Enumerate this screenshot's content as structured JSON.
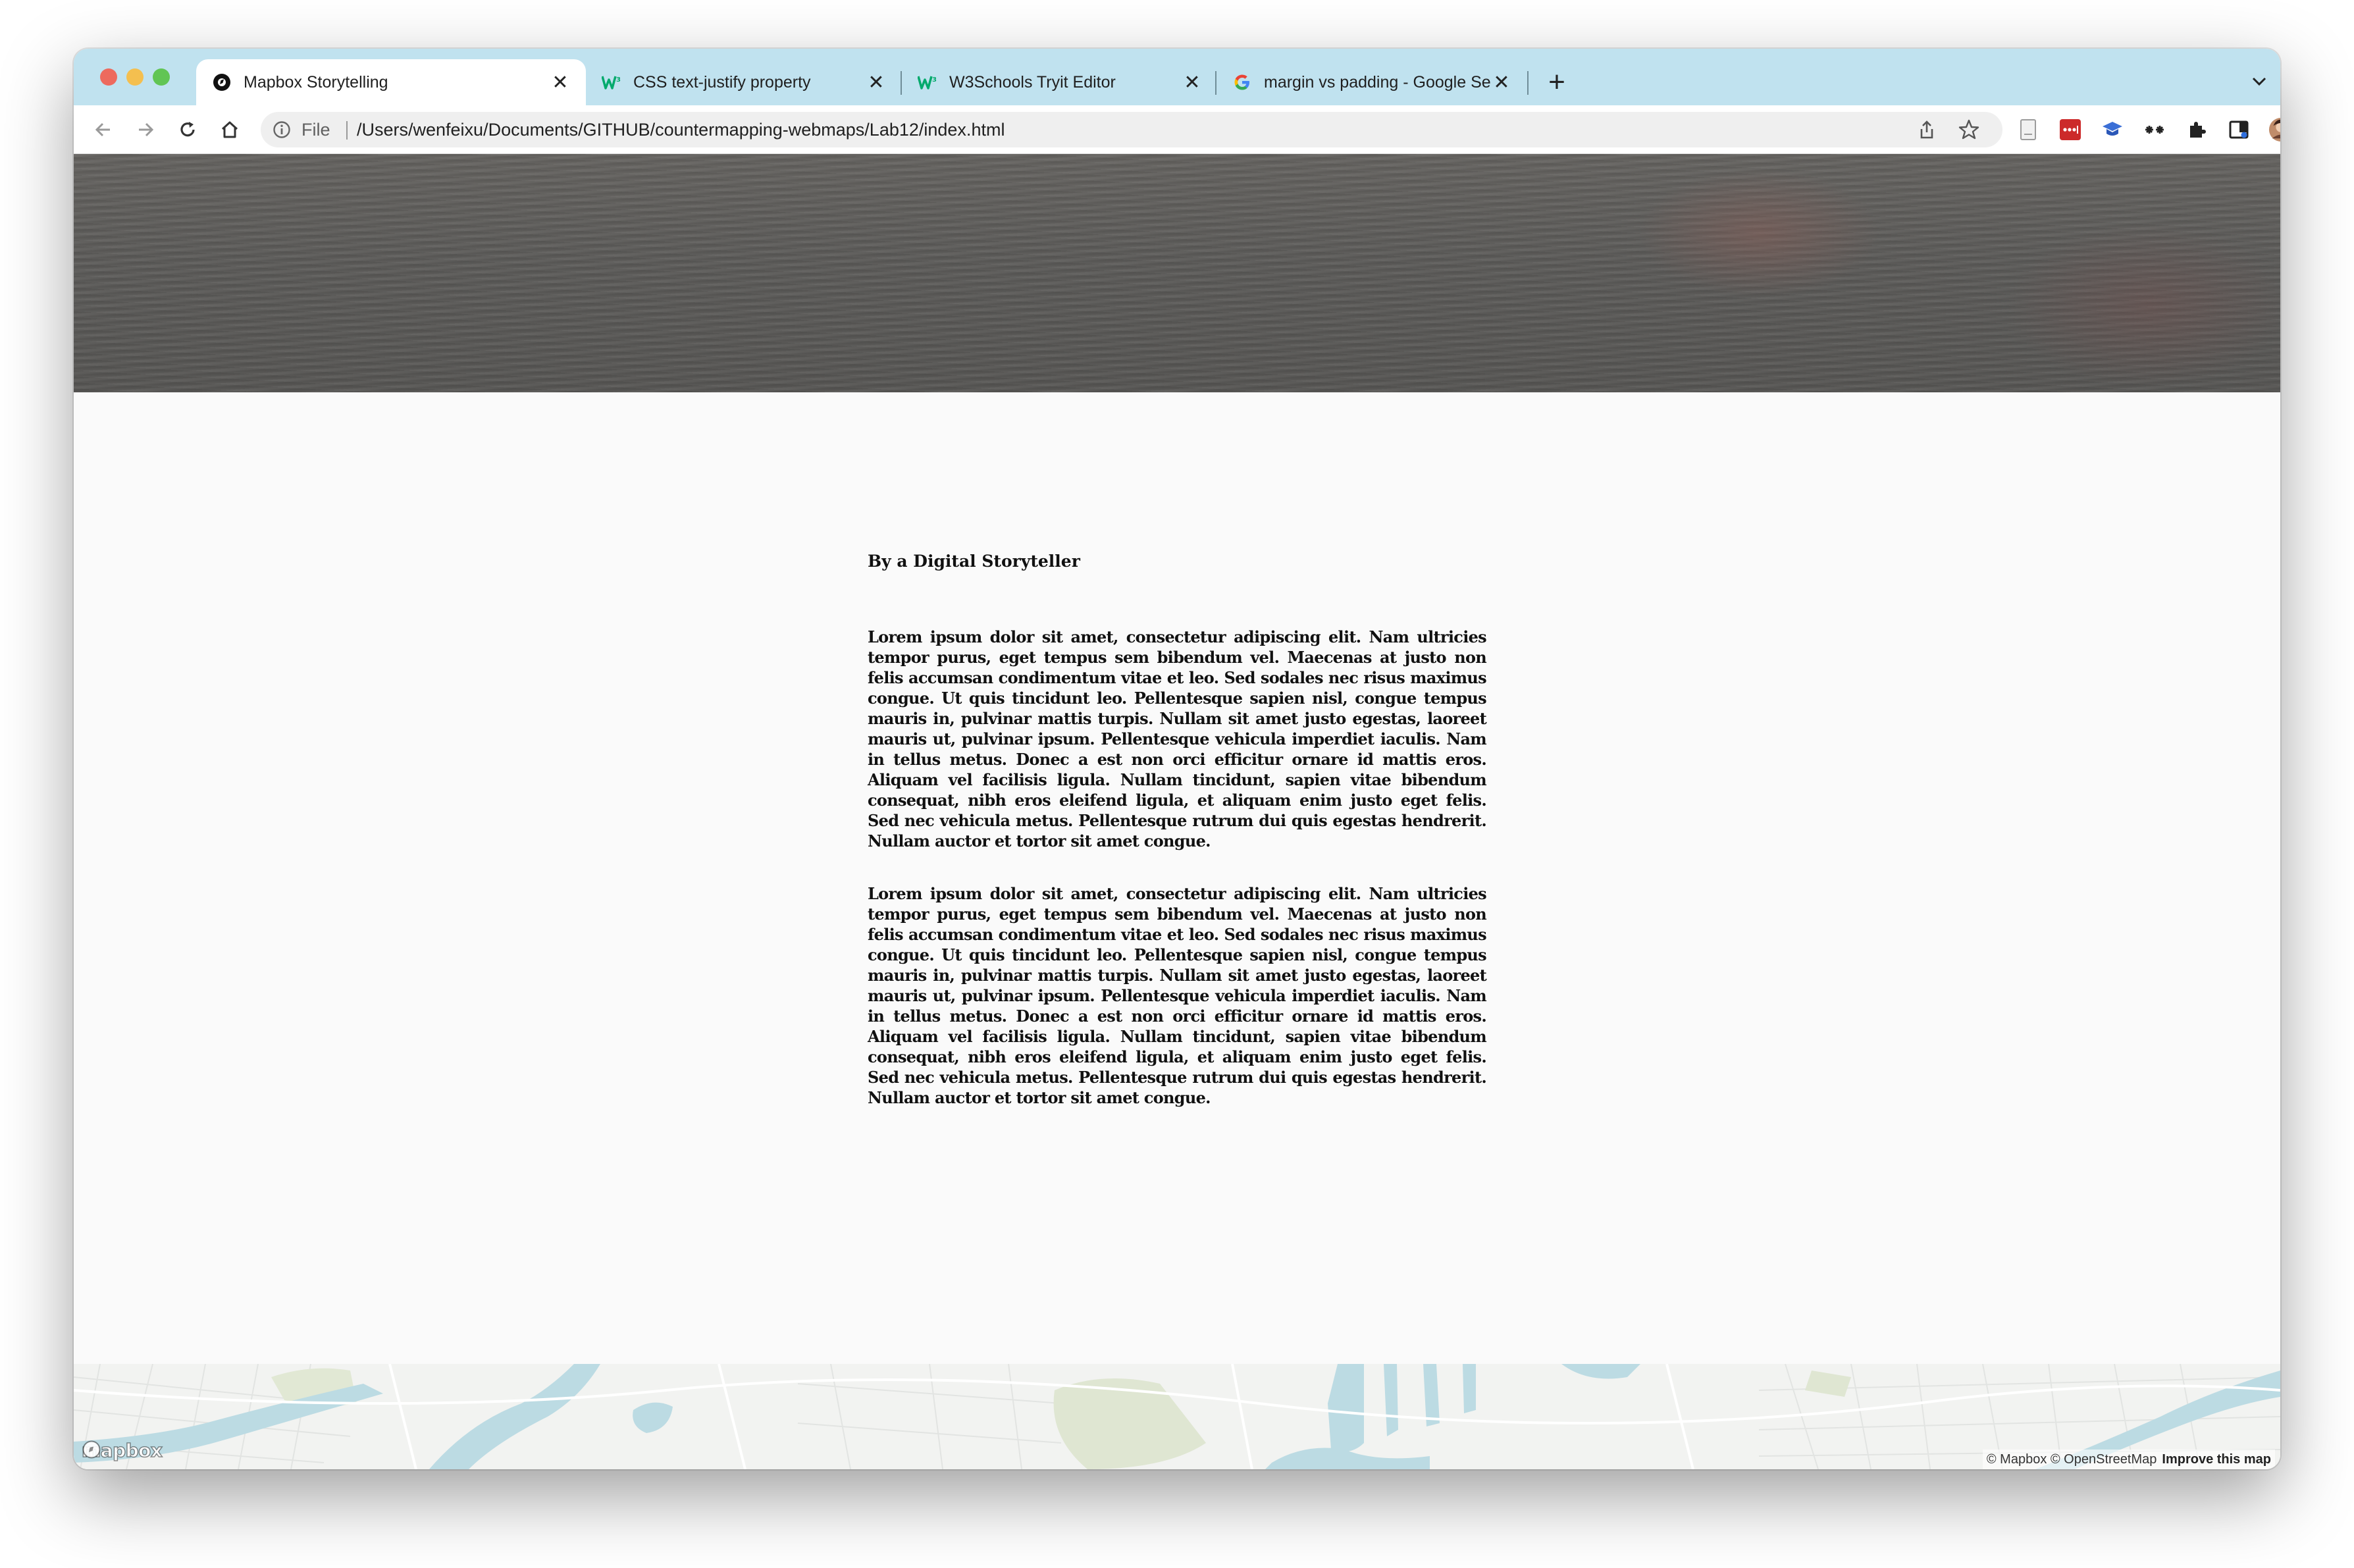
{
  "browser": {
    "tabs": [
      {
        "title": "Mapbox Storytelling",
        "favicon": "mapbox-icon",
        "active": true
      },
      {
        "title": "CSS text-justify property",
        "favicon": "w3schools-icon",
        "active": false
      },
      {
        "title": "W3Schools Tryit Editor",
        "favicon": "w3schools-icon",
        "active": false
      },
      {
        "title": "margin vs padding - Google Se",
        "favicon": "google-icon",
        "active": false
      }
    ],
    "new_tab": "+",
    "address": {
      "scheme_label": "File",
      "url": "/Users/wenfeixu/Documents/GITHUB/countermapping-webmaps/Lab12/index.html"
    },
    "close_glyph": "✕"
  },
  "page": {
    "byline": "By a Digital Storyteller",
    "paragraphs": [
      "Lorem ipsum dolor sit amet, consectetur adipiscing elit. Nam ultricies tempor purus, eget tempus sem bibendum vel. Maecenas at justo non felis accumsan condimentum vitae et leo. Sed sodales nec risus maximus congue. Ut quis tincidunt leo. Pellentesque sapien nisl, congue tempus mauris in, pulvinar mattis turpis. Nullam sit amet justo egestas, laoreet mauris ut, pulvinar ipsum. Pellentesque vehicula imperdiet iaculis. Nam in tellus metus. Donec a est non orci efficitur ornare id mattis eros. Aliquam vel facilisis ligula. Nullam tincidunt, sapien vitae bibendum consequat, nibh eros eleifend ligula, et aliquam enim justo eget felis. Sed nec vehicula metus. Pellentesque rutrum dui quis egestas hendrerit. Nullam auctor et tortor sit amet congue.",
      "Lorem ipsum dolor sit amet, consectetur adipiscing elit. Nam ultricies tempor purus, eget tempus sem bibendum vel. Maecenas at justo non felis accumsan condimentum vitae et leo. Sed sodales nec risus maximus congue. Ut quis tincidunt leo. Pellentesque sapien nisl, congue tempus mauris in, pulvinar mattis turpis. Nullam sit amet justo egestas, laoreet mauris ut, pulvinar ipsum. Pellentesque vehicula imperdiet iaculis. Nam in tellus metus. Donec a est non orci efficitur ornare id mattis eros. Aliquam vel facilisis ligula. Nullam tincidunt, sapien vitae bibendum consequat, nibh eros eleifend ligula, et aliquam enim justo eget felis. Sed nec vehicula metus. Pellentesque rutrum dui quis egestas hendrerit. Nullam auctor et tortor sit amet congue."
    ]
  },
  "map": {
    "logo_text": "mapbox",
    "attribution": "© Mapbox © OpenStreetMap",
    "improve_link": "Improve this map"
  },
  "colors": {
    "tab_strip": "#c0e2ef",
    "page_bg": "#fafafa",
    "water": "#bcdbe3",
    "park": "#dfe6d2"
  }
}
